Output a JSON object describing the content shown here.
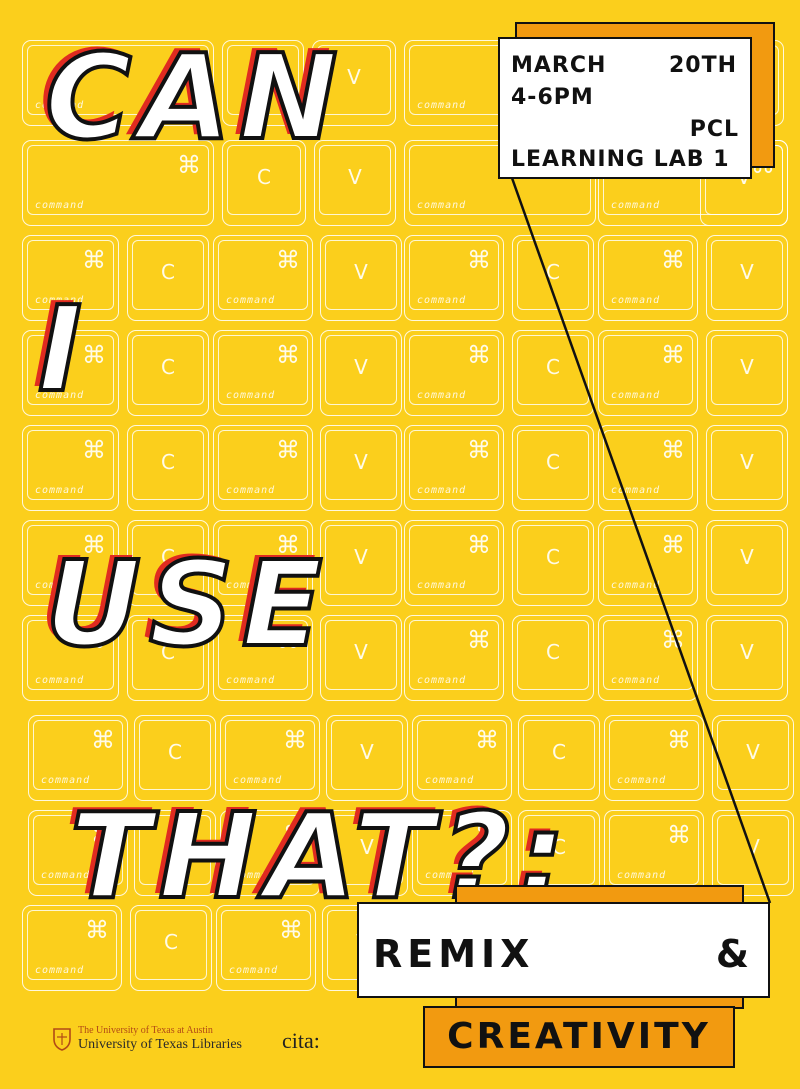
{
  "background_keys": {
    "command_word": "command",
    "command_glyph": "⌘",
    "copy_letter": "C",
    "paste_letter": "V"
  },
  "title": {
    "line1": "CAN",
    "line2": "I",
    "line3": "USE",
    "line4": "THAT?:"
  },
  "event": {
    "month": "MARCH",
    "day": "20TH",
    "time": "4-6PM",
    "building": "PCL",
    "room": "LEARNING LAB 1"
  },
  "subtitle": {
    "word1": "REMIX",
    "amp": "&",
    "word2": "CREATIVITY"
  },
  "logos": {
    "ut_line1": "The University of Texas at Austin",
    "ut_line2": "University of Texas Libraries",
    "cita": "cita:"
  },
  "colors": {
    "background": "#fbcf1c",
    "accent_orange": "#f29a10",
    "shadow_red": "#e02b20"
  }
}
